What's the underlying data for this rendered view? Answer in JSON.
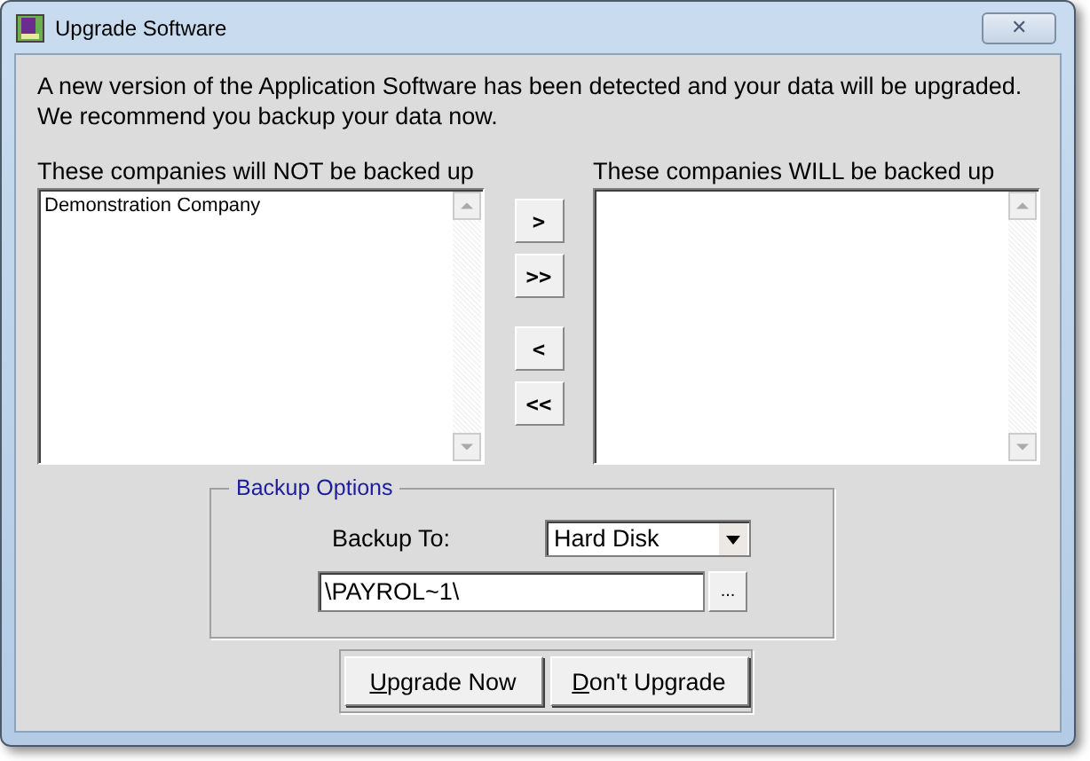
{
  "window": {
    "title": "Upgrade Software",
    "close_glyph": "✕"
  },
  "message": [
    "A new version of the Application Software has been detected and your data will be upgraded.",
    "We recommend you backup your data now."
  ],
  "lists": [
    {
      "label": "These companies will NOT be backed up",
      "items": [
        "Demonstration Company"
      ]
    },
    {
      "label": "These companies WILL be backed up"
    }
  ],
  "move_buttons": [
    ">",
    ">>",
    "<",
    "<<"
  ],
  "backup_options": {
    "title": "Backup Options",
    "backup_to_label": "Backup To:",
    "backup_to_value": "Hard Disk",
    "path_value": "\\PAYROL~1\\",
    "browse_label": "..."
  },
  "actions": [
    {
      "accel": "U",
      "rest": "pgrade Now"
    },
    {
      "accel": "D",
      "rest": "on't Upgrade"
    }
  ]
}
